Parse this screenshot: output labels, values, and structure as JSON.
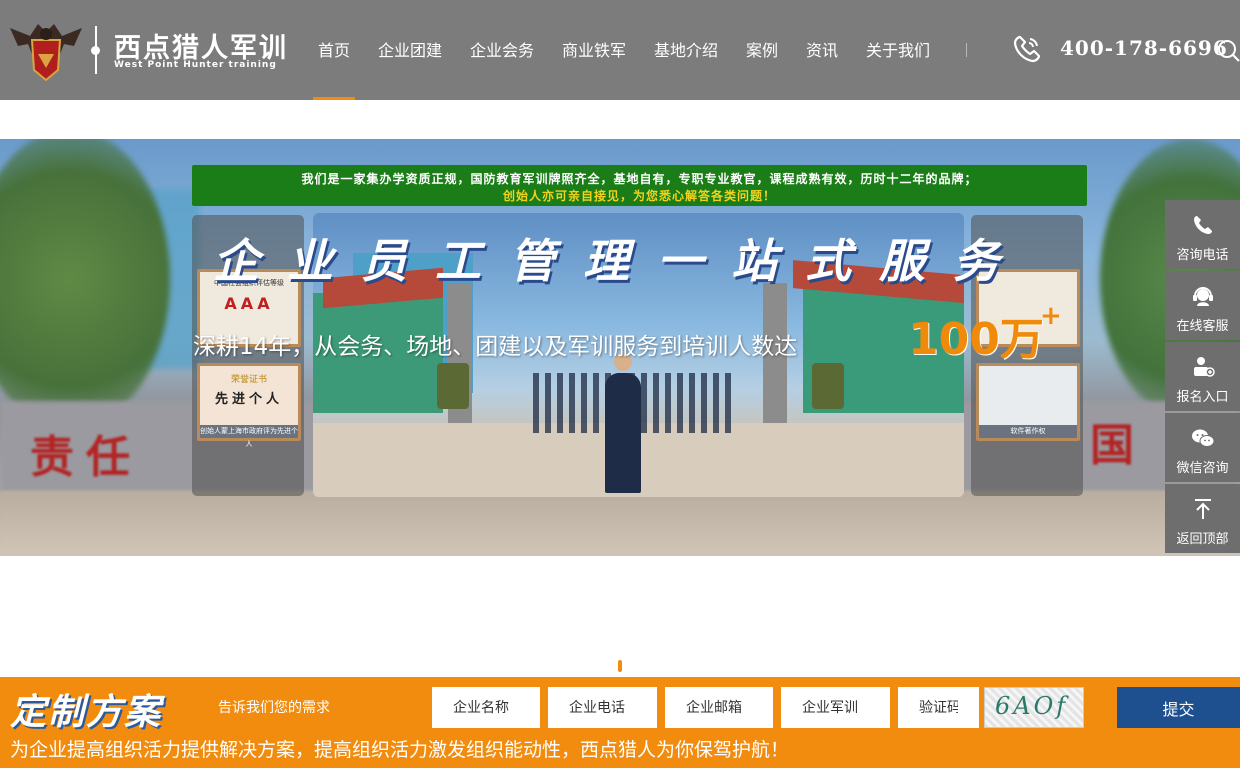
{
  "header": {
    "logo_cn": "西点猎人军训",
    "logo_en": "West Point Hunter training",
    "nav": [
      "首页",
      "企业团建",
      "企业会务",
      "商业铁军",
      "基地介绍",
      "案例",
      "资讯",
      "关于我们"
    ],
    "active_nav": "首页",
    "phone": "400-178-6696"
  },
  "banner": {
    "notice_line1": "我们是一家集办学资质正规，国防教育军训牌照齐全，基地自有，专职专业教官，课程成熟有效，历时十二年的品牌；",
    "notice_line2": "创始人亦可亲自接见，为您悉心解答各类问题！",
    "headline": "企业员工管理一站式服务",
    "sub": "深耕14年，从会务、场地、团建以及军训服务到培训人数达",
    "highlight_number": "100万",
    "highlight_plus": "+",
    "cert_left_1_title": "中国社会组织评估等级",
    "cert_left_1_big": "AAA",
    "cert_left_2_title": "荣誉证书",
    "cert_left_2_big": "先进个人",
    "cert_left_2_caption": "创始人蒙上海市政府评为先进个人",
    "cert_right_2_caption": "软件著作权",
    "wall_text_left": "责任",
    "wall_text_right": "国"
  },
  "sidebar": [
    {
      "label": "咨询电话",
      "icon": "phone-icon"
    },
    {
      "label": "在线客服",
      "icon": "headset-icon"
    },
    {
      "label": "报名入口",
      "icon": "signup-icon"
    },
    {
      "label": "微信咨询",
      "icon": "wechat-icon"
    },
    {
      "label": "返回顶部",
      "icon": "back-to-top-icon"
    }
  ],
  "form": {
    "title": "定制方案",
    "subtitle": "告诉我们您的需求",
    "fields": {
      "company_name": "企业名称",
      "company_phone": "企业电话",
      "company_email": "企业邮箱",
      "company_training": "企业军训",
      "captcha": "验证码"
    },
    "captcha_text": "6AOf",
    "submit": "提交",
    "slogan": "为企业提高组织活力提供解决方案，提高组织活力激发组织能动性，西点猎人为你保驾护航！"
  },
  "colors": {
    "accent": "#f28c0f",
    "header_bg": "#7c7c7c",
    "submit_bg": "#1e4f8f",
    "notice_bg": "#1a7d17"
  }
}
